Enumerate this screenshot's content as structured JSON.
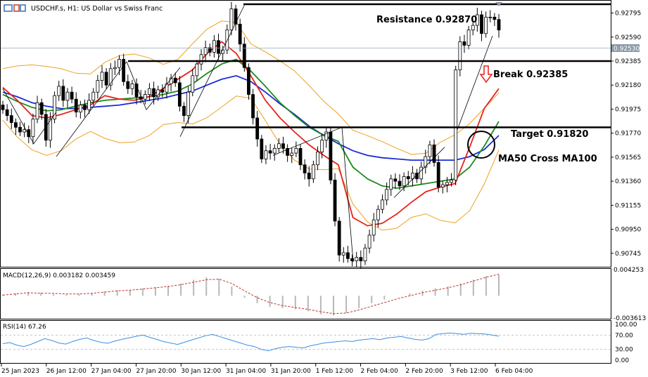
{
  "header": {
    "symbol": "USDCHF.s, H1:  US Dollar vs Swiss Franc"
  },
  "colors": {
    "candle": "#000000",
    "ma_fast": "#e8231a",
    "ma50": "#1f8a1f",
    "ma100": "#1b2bd8",
    "bollinger": "#f0a020",
    "macd_signal": "#c0302a",
    "macd_hist": "#b8b8b8",
    "rsi": "#3b8fe0",
    "price_line": "#99aabb",
    "arrow": "#e0231c"
  },
  "chart_data": [
    {
      "type": "line",
      "panel": "price",
      "x_ticks": [
        "25 Jan 2023",
        "26 Jan 12:00",
        "27 Jan 04:00",
        "27 Jan 20:00",
        "30 Jan 12:00",
        "31 Jan 04:00",
        "31 Jan 20:00",
        "1 Feb 12:00",
        "2 Feb 04:00",
        "2 Feb 20:00",
        "3 Feb 12:00",
        "6 Feb 04:00"
      ],
      "y_ticks": [
        "0.92795",
        "0.92590",
        "0.92385",
        "0.92180",
        "0.91975",
        "0.91770",
        "0.91565",
        "0.91360",
        "0.91155",
        "0.90950",
        "0.90745"
      ],
      "ylim": [
        0.9063,
        0.929
      ],
      "current_price": "0.92530",
      "series": [
        {
          "name": "Close",
          "values": [
            0.9197,
            0.9192,
            0.9186,
            0.9182,
            0.9178,
            0.918,
            0.9174,
            0.9189,
            0.9203,
            0.9193,
            0.9171,
            0.9189,
            0.9209,
            0.9217,
            0.9205,
            0.9212,
            0.9206,
            0.9195,
            0.9201,
            0.9197,
            0.9205,
            0.9212,
            0.9222,
            0.9229,
            0.9218,
            0.9232,
            0.9233,
            0.924,
            0.9221,
            0.9215,
            0.9219,
            0.9208,
            0.9206,
            0.921,
            0.9215,
            0.9208,
            0.9214,
            0.9212,
            0.9219,
            0.9224,
            0.922,
            0.92,
            0.9192,
            0.9212,
            0.9226,
            0.9236,
            0.9244,
            0.925,
            0.9246,
            0.9256,
            0.9245,
            0.9248,
            0.9265,
            0.9283,
            0.927,
            0.9253,
            0.9233,
            0.921,
            0.919,
            0.9172,
            0.9155,
            0.9162,
            0.916,
            0.9164,
            0.9168,
            0.9164,
            0.9158,
            0.916,
            0.9164,
            0.915,
            0.9143,
            0.9138,
            0.915,
            0.9161,
            0.9171,
            0.9178,
            0.9137,
            0.9102,
            0.9073,
            0.9075,
            0.907,
            0.9068,
            0.9071,
            0.9068,
            0.9079,
            0.909,
            0.9103,
            0.9112,
            0.912,
            0.9129,
            0.9138,
            0.9136,
            0.9132,
            0.914,
            0.9138,
            0.9143,
            0.9138,
            0.9148,
            0.9157,
            0.9167,
            0.9152,
            0.9131,
            0.9133,
            0.9135,
            0.9137,
            0.9231,
            0.9255,
            0.9252,
            0.9265,
            0.9269,
            0.9278,
            0.9262,
            0.9276,
            0.9276,
            0.9274,
            0.9265
          ]
        },
        {
          "name": "MA fast",
          "values": [
            0.9216,
            0.9205,
            0.9192,
            0.919,
            0.9193,
            0.9197,
            0.9201,
            0.9209,
            0.9206,
            0.9205,
            0.9208,
            0.9215,
            0.9223,
            0.9231,
            0.9245,
            0.9255,
            0.9245,
            0.9226,
            0.9205,
            0.919,
            0.9178,
            0.9167,
            0.9158,
            0.915,
            0.9105,
            0.9098,
            0.91,
            0.9108,
            0.9118,
            0.9127,
            0.9131,
            0.9134,
            0.9165,
            0.9198,
            0.9215
          ]
        },
        {
          "name": "MA50",
          "values": [
            0.921,
            0.9204,
            0.9199,
            0.9196,
            0.9197,
            0.92,
            0.9203,
            0.9205,
            0.9206,
            0.9207,
            0.9208,
            0.921,
            0.9213,
            0.9219,
            0.9228,
            0.9236,
            0.924,
            0.923,
            0.9217,
            0.9203,
            0.9192,
            0.9182,
            0.9175,
            0.917,
            0.9148,
            0.9138,
            0.9132,
            0.913,
            0.9132,
            0.9134,
            0.9136,
            0.9138,
            0.9148,
            0.9166,
            0.9187
          ]
        },
        {
          "name": "MA100",
          "values": [
            0.9212,
            0.9208,
            0.9203,
            0.92,
            0.9198,
            0.9198,
            0.9199,
            0.92,
            0.9201,
            0.9203,
            0.9205,
            0.9207,
            0.921,
            0.9213,
            0.9218,
            0.9223,
            0.9226,
            0.9221,
            0.9212,
            0.9202,
            0.9193,
            0.9183,
            0.9175,
            0.9168,
            0.9162,
            0.9158,
            0.9156,
            0.9155,
            0.9154,
            0.9154,
            0.9154,
            0.9154,
            0.9157,
            0.9163,
            0.9175
          ]
        }
      ],
      "annotations": [
        {
          "text": "Resistance 0.92870",
          "y": 0.9287
        },
        {
          "text": "Break 0.92385",
          "y": 0.92385
        },
        {
          "text": "Target 0.91820",
          "y": 0.9182
        },
        {
          "text": "MA50 Cross MA100"
        }
      ]
    },
    {
      "type": "bar",
      "panel": "macd",
      "label": "MACD(12,26,9) 0.003182 0.003459",
      "y_ticks": [
        "0.004253",
        "-0.003613"
      ],
      "ylim": [
        -0.003613,
        0.004253
      ],
      "values": [
        0.0002,
        0.0004,
        0.0006,
        0.0005,
        0.0003,
        0.0002,
        0.0003,
        0.0005,
        0.0007,
        0.0009,
        0.001,
        0.0012,
        0.0014,
        0.0016,
        0.002,
        0.0026,
        0.003,
        0.0028,
        0.0015,
        -0.0003,
        -0.0012,
        -0.0018,
        -0.002,
        -0.0022,
        -0.0025,
        -0.003,
        -0.0032,
        -0.0028,
        -0.002,
        -0.0012,
        -0.0006,
        0.0,
        0.0004,
        0.0008,
        0.0012,
        0.0015,
        0.002,
        0.0026,
        0.0032,
        0.0034
      ],
      "signal": [
        0.0001,
        0.0003,
        0.0005,
        0.0004,
        0.0004,
        0.0003,
        0.0003,
        0.0004,
        0.0006,
        0.0008,
        0.0009,
        0.0011,
        0.0013,
        0.0015,
        0.0018,
        0.0022,
        0.0026,
        0.0027,
        0.002,
        0.0008,
        -0.0003,
        -0.0011,
        -0.0016,
        -0.0019,
        -0.0022,
        -0.0026,
        -0.0029,
        -0.0028,
        -0.0023,
        -0.0017,
        -0.0011,
        -0.0005,
        0.0,
        0.0005,
        0.0009,
        0.0013,
        0.0018,
        0.0024,
        0.003,
        0.0035
      ]
    },
    {
      "type": "line",
      "panel": "rsi",
      "label": "RSI(14) 67.26",
      "y_ticks": [
        "100.00",
        "70.00",
        "30.00",
        "0.00"
      ],
      "ylim": [
        0,
        100
      ],
      "values": [
        46,
        49,
        42,
        38,
        44,
        52,
        60,
        55,
        48,
        45,
        52,
        58,
        62,
        55,
        50,
        47,
        53,
        58,
        62,
        66,
        70,
        64,
        58,
        52,
        48,
        44,
        50,
        56,
        62,
        68,
        72,
        66,
        60,
        54,
        48,
        42,
        38,
        30,
        26,
        32,
        36,
        38,
        36,
        34,
        40,
        44,
        48,
        50,
        52,
        54,
        52,
        56,
        58,
        60,
        57,
        62,
        64,
        66,
        62,
        58,
        56,
        60,
        72,
        74,
        76,
        74,
        72,
        75,
        74,
        73,
        70,
        67
      ]
    }
  ]
}
